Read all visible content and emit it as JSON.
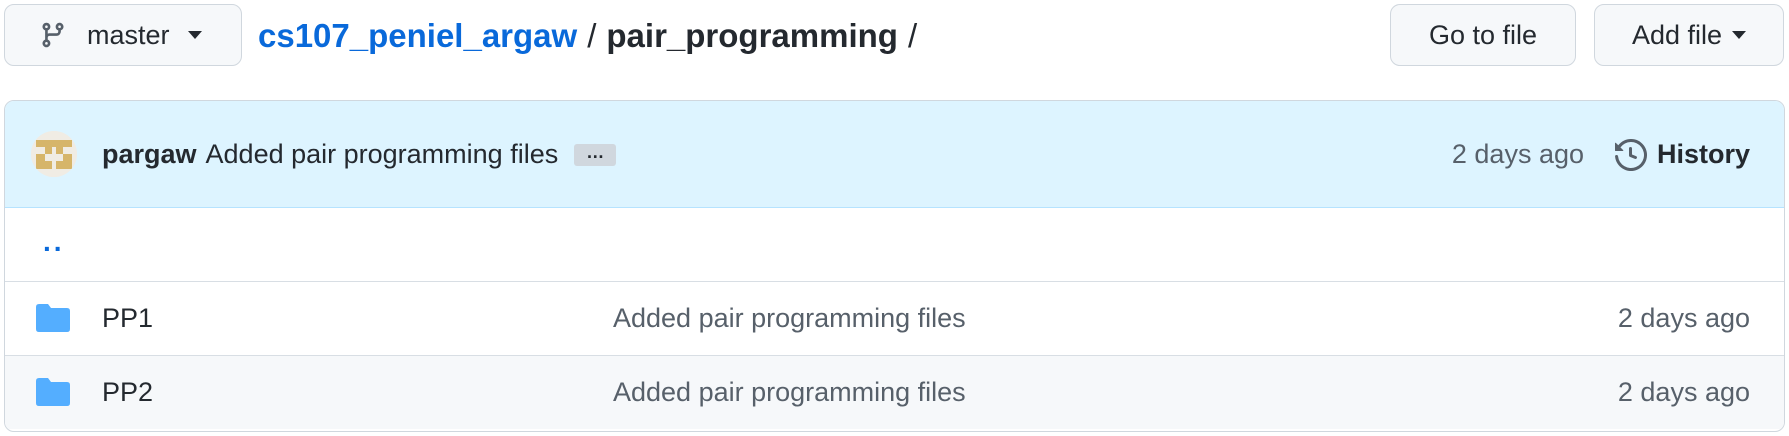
{
  "branch": {
    "name": "master"
  },
  "breadcrumb": {
    "repo": "cs107_peniel_argaw",
    "separator": "/",
    "directory": "pair_programming",
    "trailing": "/"
  },
  "actions": {
    "go_to_file": "Go to file",
    "add_file": "Add file"
  },
  "latest_commit": {
    "author": "pargaw",
    "message": "Added pair programming files",
    "ellipsis": "…",
    "date": "2 days ago",
    "history_label": "History"
  },
  "parent_dir": {
    "label": ".."
  },
  "files": [
    {
      "name": "PP1",
      "type": "folder",
      "message": "Added pair programming files",
      "date": "2 days ago"
    },
    {
      "name": "PP2",
      "type": "folder",
      "message": "Added pair programming files",
      "date": "2 days ago"
    }
  ],
  "colors": {
    "link": "#0969da",
    "commit_bar": "#ddf4ff",
    "folder": "#54aeff",
    "avatar": "#d6b56a"
  }
}
